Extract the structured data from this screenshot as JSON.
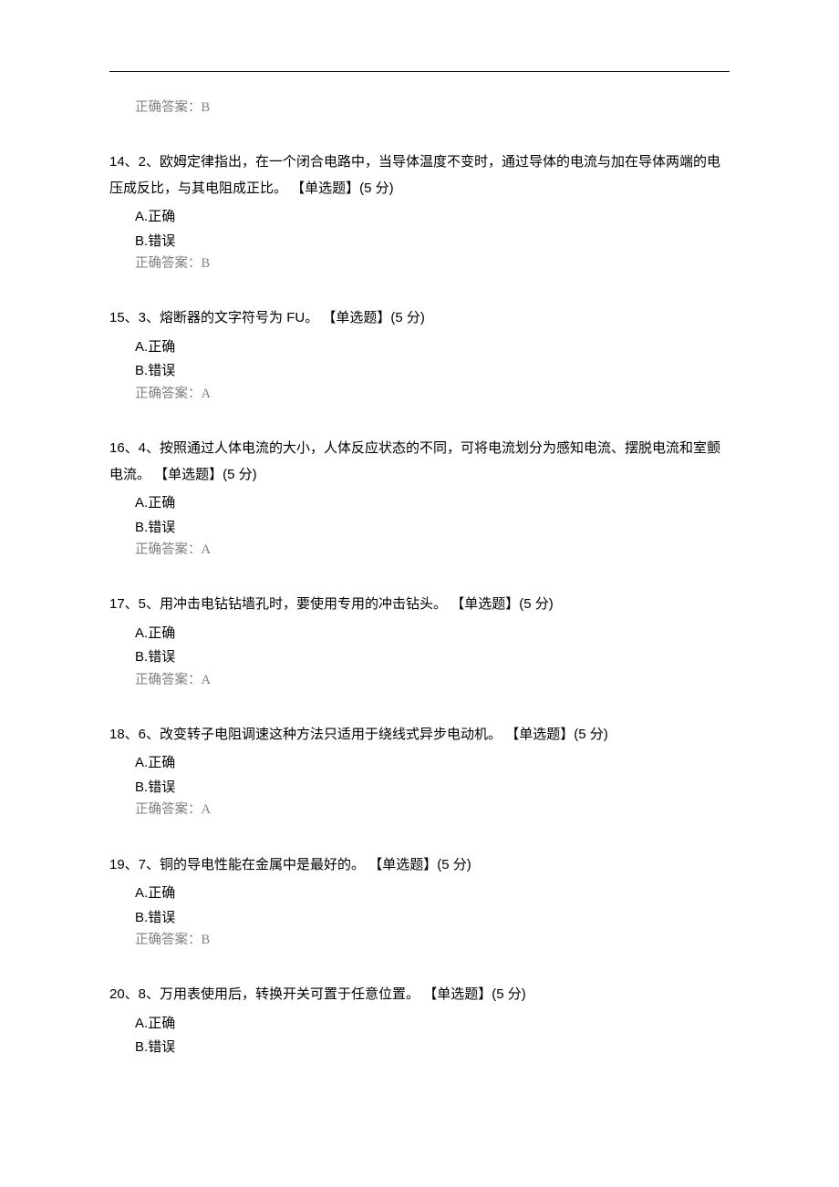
{
  "answer_label_prefix": "正确答案：",
  "options_common": {
    "A_letter": "A.",
    "A_text": "正确",
    "B_letter": "B.",
    "B_text": "错误"
  },
  "orphan_answer": "B",
  "questions": [
    {
      "stem": "14、2、欧姆定律指出，在一个闭合电路中，当导体温度不变时，通过导体的电流与加在导体两端的电压成反比，与其电阻成正比。 【单选题】(5 分)",
      "answer": "B"
    },
    {
      "stem": "15、3、熔断器的文字符号为 FU。 【单选题】(5 分)",
      "answer": "A"
    },
    {
      "stem": "16、4、按照通过人体电流的大小，人体反应状态的不同，可将电流划分为感知电流、摆脱电流和室颤电流。 【单选题】(5 分)",
      "answer": "A"
    },
    {
      "stem": "17、5、用冲击电钻钻墙孔时，要使用专用的冲击钻头。 【单选题】(5 分)",
      "answer": "A"
    },
    {
      "stem": "18、6、改变转子电阻调速这种方法只适用于绕线式异步电动机。 【单选题】(5 分)",
      "answer": "A"
    },
    {
      "stem": "19、7、铜的导电性能在金属中是最好的。 【单选题】(5 分)",
      "answer": "B"
    },
    {
      "stem": "20、8、万用表使用后，转换开关可置于任意位置。 【单选题】(5 分)",
      "answer": null
    }
  ]
}
